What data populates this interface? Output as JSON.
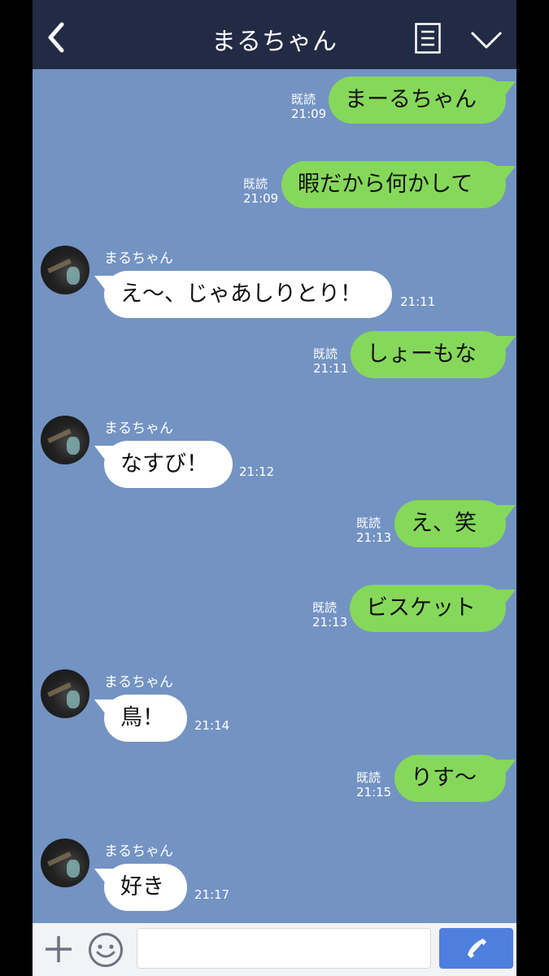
{
  "header": {
    "title": "まるちゃん",
    "back_icon": "chevron-left-icon",
    "memo_icon": "note-icon",
    "menu_icon": "chevron-down-icon"
  },
  "contact": {
    "name": "まるちゃん"
  },
  "messages": [
    {
      "dir": "out",
      "text": "まーるちゃん",
      "read": "既読",
      "time": "21:09"
    },
    {
      "dir": "out",
      "text": "暇だから何かして",
      "read": "既読",
      "time": "21:09"
    },
    {
      "dir": "in",
      "sender": "まるちゃん",
      "text": "え〜、じゃあしりとり！",
      "time": "21:11"
    },
    {
      "dir": "out",
      "text": "しょーもな",
      "read": "既読",
      "time": "21:11"
    },
    {
      "dir": "in",
      "sender": "まるちゃん",
      "text": "なすび！",
      "time": "21:12"
    },
    {
      "dir": "out",
      "text": "え、笑",
      "read": "既読",
      "time": "21:13"
    },
    {
      "dir": "out",
      "text": "ビスケット",
      "read": "既読",
      "time": "21:13"
    },
    {
      "dir": "in",
      "sender": "まるちゃん",
      "text": "鳥！",
      "time": "21:14"
    },
    {
      "dir": "out",
      "text": "りす〜",
      "read": "既読",
      "time": "21:15"
    },
    {
      "dir": "in",
      "sender": "まるちゃん",
      "text": "好き",
      "time": "21:17"
    }
  ],
  "footer": {
    "message_input_value": "",
    "plus_icon": "plus-icon",
    "emoji_icon": "smiley-icon",
    "call_icon": "phone-icon"
  },
  "colors": {
    "header_bg": "#222b44",
    "chat_bg": "#7393c3",
    "outgoing_bubble": "#86d85a",
    "incoming_bubble": "#ffffff",
    "call_button": "#4f7fde"
  }
}
